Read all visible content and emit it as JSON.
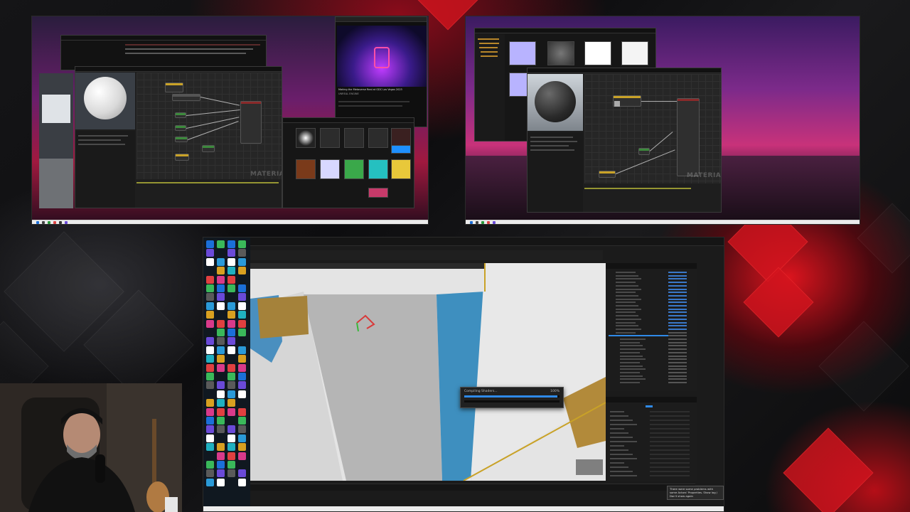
{
  "screens": {
    "top_left": {
      "material_label": "MATERIAL",
      "video_title": "Making the Metaverse Real at GDC Las Vegas 2023",
      "video_channel": "UNREAL ENGINE"
    },
    "top_right": {
      "material_label": "MATERIAL"
    },
    "main": {
      "progress_dialog": {
        "label": "Compiling Shaders...",
        "percent_text": "100%",
        "progress": 0.98
      },
      "notification": {
        "text": "There were some problems with some Actors' Properties. Show log / Don't show again"
      }
    }
  },
  "colors": {
    "accent_blue": "#2f8ae8",
    "viewport_bg": "#e4e4e4",
    "surface_blue": "#3e8fbf",
    "background_red": "#d41a22"
  },
  "icons": [
    "ue-icon",
    "chrome-icon",
    "discord-icon",
    "folder-icon",
    "vs-icon",
    "obs-icon"
  ]
}
